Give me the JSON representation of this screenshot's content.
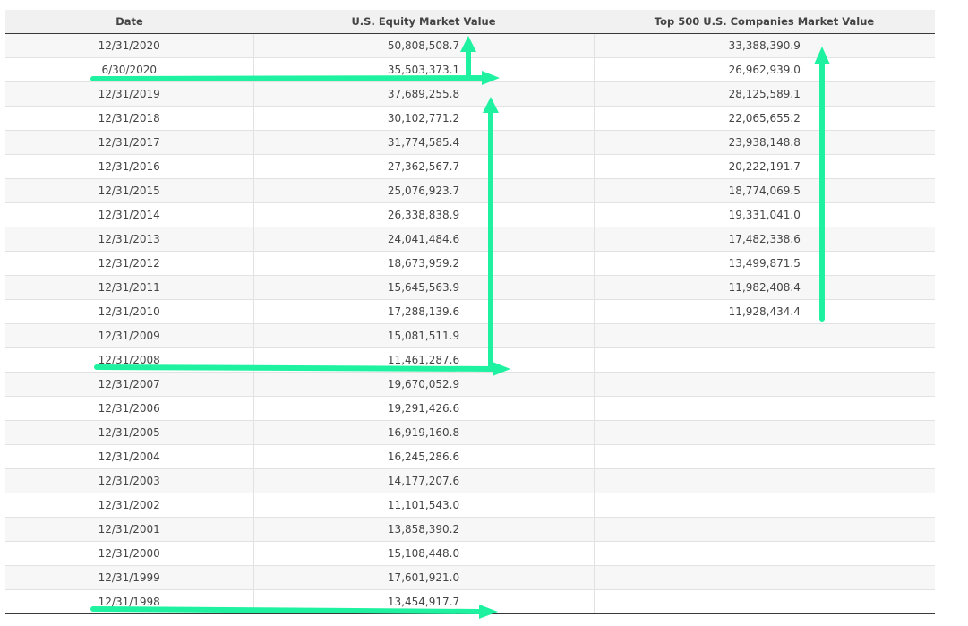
{
  "chart_data": {
    "type": "table",
    "columns": [
      "Date",
      "U.S. Equity Market Value",
      "Top 500 U.S. Companies Market Value"
    ],
    "rows": [
      [
        "12/31/2020",
        "50,808,508.7",
        "33,388,390.9"
      ],
      [
        "6/30/2020",
        "35,503,373.1",
        "26,962,939.0"
      ],
      [
        "12/31/2019",
        "37,689,255.8",
        "28,125,589.1"
      ],
      [
        "12/31/2018",
        "30,102,771.2",
        "22,065,655.2"
      ],
      [
        "12/31/2017",
        "31,774,585.4",
        "23,938,148.8"
      ],
      [
        "12/31/2016",
        "27,362,567.7",
        "20,222,191.7"
      ],
      [
        "12/31/2015",
        "25,076,923.7",
        "18,774,069.5"
      ],
      [
        "12/31/2014",
        "26,338,838.9",
        "19,331,041.0"
      ],
      [
        "12/31/2013",
        "24,041,484.6",
        "17,482,338.6"
      ],
      [
        "12/31/2012",
        "18,673,959.2",
        "13,499,871.5"
      ],
      [
        "12/31/2011",
        "15,645,563.9",
        "11,982,408.4"
      ],
      [
        "12/31/2010",
        "17,288,139.6",
        "11,928,434.4"
      ],
      [
        "12/31/2009",
        "15,081,511.9",
        ""
      ],
      [
        "12/31/2008",
        "11,461,287.6",
        ""
      ],
      [
        "12/31/2007",
        "19,670,052.9",
        ""
      ],
      [
        "12/31/2006",
        "19,291,426.6",
        ""
      ],
      [
        "12/31/2005",
        "16,919,160.8",
        ""
      ],
      [
        "12/31/2004",
        "16,245,286.6",
        ""
      ],
      [
        "12/31/2003",
        "14,177,207.6",
        ""
      ],
      [
        "12/31/2002",
        "11,101,543.0",
        ""
      ],
      [
        "12/31/2001",
        "13,858,390.2",
        ""
      ],
      [
        "12/31/2000",
        "15,108,448.0",
        ""
      ],
      [
        "12/31/1999",
        "17,601,921.0",
        ""
      ],
      [
        "12/31/1998",
        "13,454,917.7",
        ""
      ]
    ],
    "annotations": [
      {
        "kind": "arrow",
        "direction": "right",
        "row": "6/30/2020"
      },
      {
        "kind": "arrow",
        "direction": "up",
        "column": "U.S. Equity Market Value",
        "from_row": "6/30/2020",
        "to_row": "12/31/2020"
      },
      {
        "kind": "arrow",
        "direction": "up",
        "column": "U.S. Equity Market Value",
        "from_row": "12/31/2008",
        "to_row": "12/31/2019"
      },
      {
        "kind": "arrow",
        "direction": "right",
        "row": "12/31/2008"
      },
      {
        "kind": "arrow",
        "direction": "right",
        "row": "12/31/1998"
      },
      {
        "kind": "arrow",
        "direction": "up",
        "column": "Top 500 U.S. Companies Market Value",
        "from_row": "12/31/2010",
        "to_row": "12/31/2020"
      }
    ]
  },
  "colors": {
    "arrow": "#1ef2a0",
    "header_bg": "#f1f1f1",
    "row_alt": "#f7f7f7"
  }
}
